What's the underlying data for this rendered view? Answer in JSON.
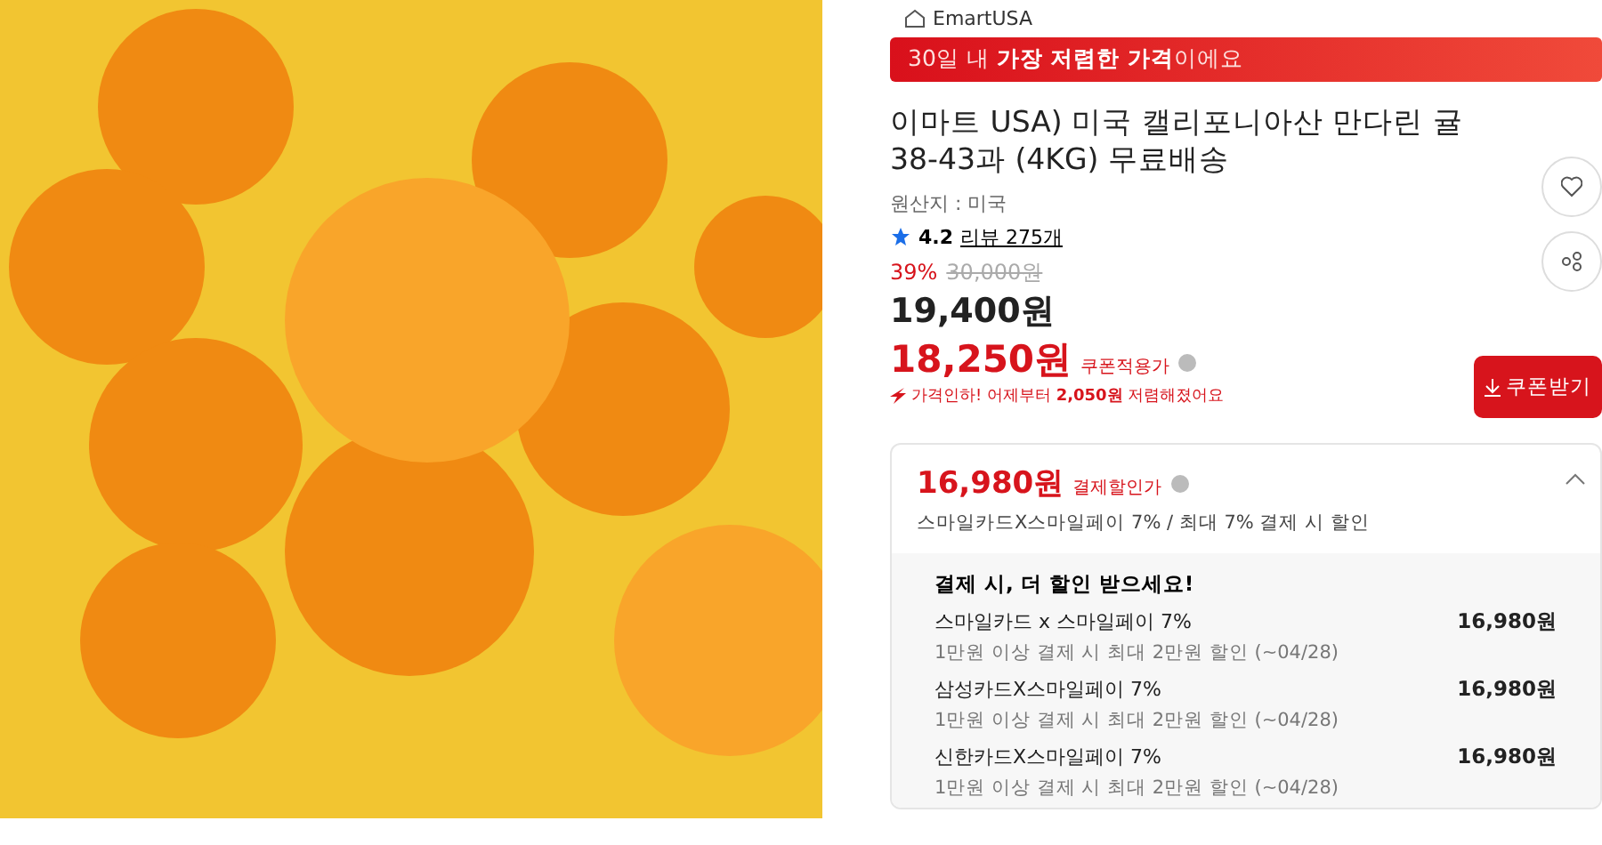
{
  "store": {
    "name": "EmartUSA"
  },
  "banner": {
    "text": "30일 내 **가장 저렴한 가격**이에요"
  },
  "title": "이마트 USA) 미국 캘리포니아산 만다린 귤 38-43과 (4KG) 무료배송",
  "origin": "원산지 : 미국",
  "rating": {
    "stars": 1,
    "score": "4.2",
    "reviews": "리뷰 275개"
  },
  "discount": "39%",
  "original_price": "30,000원",
  "price": "19,400원",
  "coupon_price": {
    "amount": "18,250원",
    "label": "쿠폰적용가"
  },
  "coupon_button": "쿠폰받기",
  "price_drop": "가격인하! 어제부터 **2,050원** 저렴해졌어요",
  "payment": {
    "amount": "16,980원",
    "label": "결제할인가",
    "summary": "스마일카드X스마일페이 7% / 최대 7% 결제 시 할인",
    "expanded": true,
    "heading": "결제 시, 더 할인 받으세요!",
    "offers": [
      {
        "name": "스마일카드 x 스마일페이 7%",
        "detail": "1만원 이상 결제 시 최대 2만원 할인 (~04/28)",
        "price": "16,980원"
      },
      {
        "name": "삼성카드X스마일페이 7%",
        "detail": "1만원 이상 결제 시 최대 2만원 할인 (~04/28)",
        "price": "16,980원"
      },
      {
        "name": "신한카드X스마일페이 7%",
        "detail": "1만원 이상 결제 시 최대 2만원 할인 (~04/28)",
        "price": "16,980원"
      }
    ]
  }
}
